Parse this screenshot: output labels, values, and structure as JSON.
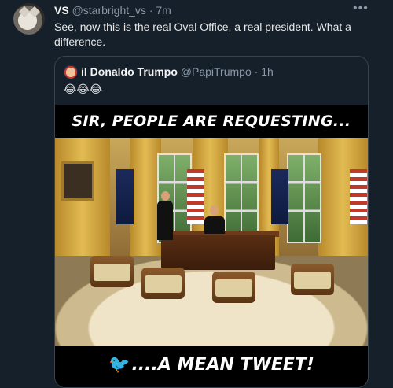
{
  "tweet": {
    "name": "VS",
    "handle": "@starbright_vs",
    "separator": "·",
    "time": "7m",
    "text": "See, now this is the real Oval Office, a real president.  What a difference."
  },
  "quoted": {
    "name": "il Donaldo Trumpo",
    "handle": "@PapiTrumpo",
    "separator": "·",
    "time": "1h",
    "emoji": "😂😂😂",
    "meme_top_text": "SIR, PEOPLE ARE REQUESTING...",
    "meme_bottom_text": "....A MEAN TWEET!"
  },
  "icons": {
    "more": "more-horizontal-icon",
    "bird": "twitter-bird-icon"
  },
  "colors": {
    "background": "#15202b",
    "muted": "#8b98a5",
    "accent": "#1d9bf0"
  }
}
